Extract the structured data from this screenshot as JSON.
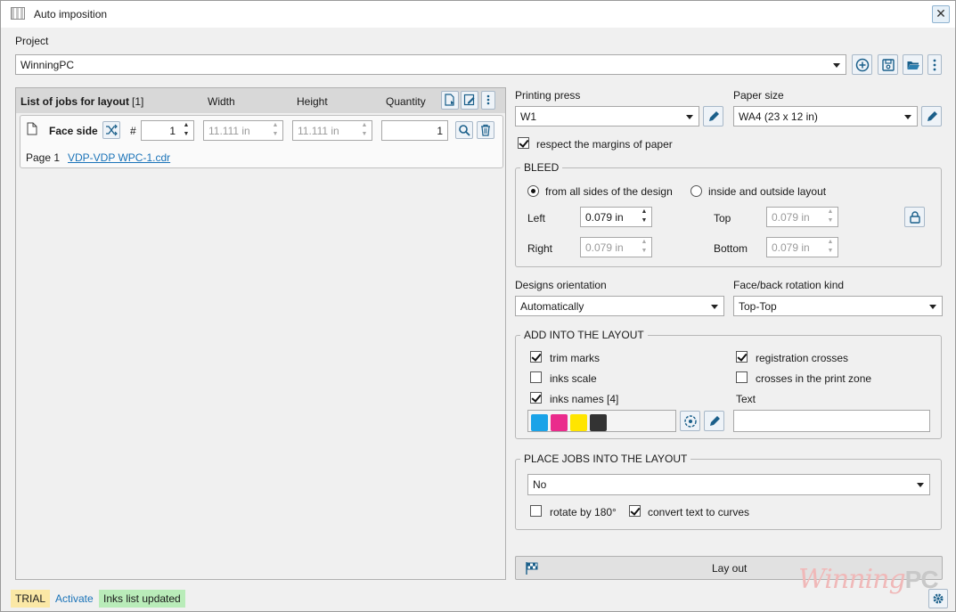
{
  "window": {
    "title": "Auto imposition",
    "close_glyph": "✕"
  },
  "project": {
    "label": "Project",
    "value": "WinningPC"
  },
  "jobs": {
    "header": {
      "title": "List of jobs for layout",
      "count": "[1]",
      "width": "Width",
      "height": "Height",
      "quantity": "Quantity"
    },
    "item": {
      "side": "Face side",
      "hash": "#",
      "number": "1",
      "width": "11.111 in",
      "height": "11.111 in",
      "quantity": "1",
      "page_label": "Page 1",
      "file": "VDP-VDP WPC-1.cdr"
    }
  },
  "printing_press": {
    "label": "Printing press",
    "value": "W1"
  },
  "paper_size": {
    "label": "Paper size",
    "value": "WA4 (23 x 12 in)"
  },
  "respect_margins": {
    "label": "respect the margins of paper",
    "checked": true
  },
  "bleed": {
    "title": "BLEED",
    "option_all": "from all sides of the design",
    "option_inside": "inside and outside layout",
    "left_label": "Left",
    "left_value": "0.079 in",
    "top_label": "Top",
    "top_value": "0.079 in",
    "right_label": "Right",
    "right_value": "0.079 in",
    "bottom_label": "Bottom",
    "bottom_value": "0.079 in"
  },
  "designs_orientation": {
    "label": "Designs orientation",
    "value": "Automatically"
  },
  "rotation_kind": {
    "label": "Face/back rotation kind",
    "value": "Top-Top"
  },
  "add_into_layout": {
    "title": "ADD INTO THE LAYOUT",
    "trim_marks": "trim marks",
    "registration_crosses": "registration crosses",
    "inks_scale": "inks scale",
    "crosses_print_zone": "crosses in the print zone",
    "inks_names": "inks names",
    "inks_names_count": "[4]",
    "text_label": "Text",
    "text_value": "",
    "ink_colors": [
      "#1aa3e8",
      "#ea2b8c",
      "#ffe500",
      "#333333"
    ]
  },
  "place_jobs": {
    "title": "PLACE JOBS INTO THE LAYOUT",
    "value": "No",
    "rotate": "rotate by 180°",
    "convert_text": "convert text to curves"
  },
  "layout_button": "Lay out",
  "status": {
    "trial": "TRIAL",
    "activate": "Activate",
    "message": "Inks list updated"
  },
  "watermark": {
    "script": "Winning",
    "bold": "PC"
  },
  "colors": {
    "accent": "#1a73b8",
    "trial_bg": "#fbe8a6",
    "message_bg": "#b9ecb9"
  }
}
